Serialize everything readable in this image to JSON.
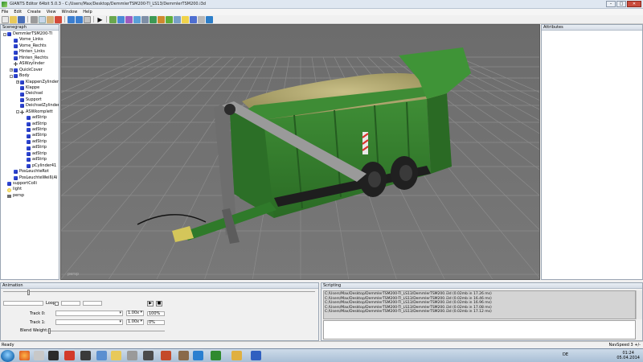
{
  "window": {
    "title": "GIANTS Editor 64bit 5.0.3 - C:/Users/Max/Desktop/DemmlerTSM200-Tl_LS13/DemmlerTSM200.i3d",
    "controls": {
      "minimize": "–",
      "maximize": "□",
      "close": "✕"
    }
  },
  "menu": [
    "File",
    "Edit",
    "Create",
    "View",
    "Window",
    "Help"
  ],
  "toolbar_icons": [
    "new-file-icon",
    "open-file-icon",
    "save-icon",
    "cut-icon",
    "copy-icon",
    "paste-icon",
    "delete-icon",
    "undo-icon",
    "redo-icon",
    "grid-icon",
    "play-icon",
    "move-icon",
    "rotate-icon",
    "scale-icon",
    "select-icon",
    "camera-icon",
    "terrain-icon",
    "paint-icon",
    "foliage-icon",
    "decal-icon",
    "light-icon",
    "shape-icon",
    "particle-icon",
    "navmesh-icon"
  ],
  "scenegraph": {
    "title": "Scenegraph",
    "nodes": [
      {
        "label": "DemmlerTSM200-Tl",
        "icon": "cube",
        "depth": 0,
        "exp": "-"
      },
      {
        "label": "Vorne_Links",
        "icon": "cube",
        "depth": 1
      },
      {
        "label": "Vorne_Rechts",
        "icon": "cube",
        "depth": 1
      },
      {
        "label": "Hinten_Links",
        "icon": "cube",
        "depth": 1
      },
      {
        "label": "Hinten_Rechts",
        "icon": "cube",
        "depth": 1
      },
      {
        "label": "ASWzylinder",
        "icon": "transform",
        "depth": 1
      },
      {
        "label": "QuickCover",
        "icon": "cube",
        "depth": 1,
        "exp": "+"
      },
      {
        "label": "Body",
        "icon": "cube",
        "depth": 1,
        "exp": "-"
      },
      {
        "label": "KlappenZylinder",
        "icon": "cube",
        "depth": 2,
        "exp": "+"
      },
      {
        "label": "Klappe",
        "icon": "cube",
        "depth": 2
      },
      {
        "label": "Deichsel",
        "icon": "cube",
        "depth": 2
      },
      {
        "label": "Support",
        "icon": "cube",
        "depth": 2
      },
      {
        "label": "DeichselZylinder",
        "icon": "cube",
        "depth": 2
      },
      {
        "label": "ASWkomplett",
        "icon": "transform",
        "depth": 2,
        "exp": "-"
      },
      {
        "label": "adStrip",
        "icon": "cube",
        "depth": 3
      },
      {
        "label": "adStrip",
        "icon": "cube",
        "depth": 3
      },
      {
        "label": "adStrip",
        "icon": "cube",
        "depth": 3
      },
      {
        "label": "adStrip",
        "icon": "cube",
        "depth": 3
      },
      {
        "label": "adStrip",
        "icon": "cube",
        "depth": 3
      },
      {
        "label": "adStrip",
        "icon": "cube",
        "depth": 3
      },
      {
        "label": "adStrip",
        "icon": "cube",
        "depth": 3
      },
      {
        "label": "adStrip",
        "icon": "cube",
        "depth": 3
      },
      {
        "label": "pCylinder41",
        "icon": "cube",
        "depth": 3
      },
      {
        "label": "PosLeuchteRot",
        "icon": "cube",
        "depth": 1
      },
      {
        "label": "PosLeuchteWeiß(Al",
        "icon": "cube",
        "depth": 1
      },
      {
        "label": "supportColli",
        "icon": "cube",
        "depth": 0
      },
      {
        "label": "light",
        "icon": "light",
        "depth": 0
      },
      {
        "label": "persp",
        "icon": "camera",
        "depth": 0
      }
    ]
  },
  "viewport": {
    "corner_label": "persp"
  },
  "attributes": {
    "title": "Attributes"
  },
  "animation": {
    "title": "Animation",
    "loop_label": "Loop",
    "track0_label": "Track 0:",
    "track1_label": "Track 1:",
    "speed0": "1.00x",
    "speed1": "1.00x",
    "weight0": "100%",
    "weight1": "0%",
    "blend_label": "Blend Weight:",
    "play_icon": "▶",
    "stop_icon": "■"
  },
  "scripting": {
    "title": "Scripting",
    "log": [
      "C:/Users/Max/Desktop/DemmlerTSM200-Tl_LS13/DemmlerTSM200.i3d (0.02mb in 17.26 ms)",
      "C:/Users/Max/Desktop/DemmlerTSM200-Tl_LS13/DemmlerTSM200.i3d (0.02mb in 16.46 ms)",
      "C:/Users/Max/Desktop/DemmlerTSM200-Tl_LS13/DemmlerTSM200.i3d (0.02mb in 16.96 ms)",
      "C:/Users/Max/Desktop/DemmlerTSM200-Tl_LS13/DemmlerTSM200.i3d (0.02mb in 17.08 ms)",
      "C:/Users/Max/Desktop/DemmlerTSM200-Tl_LS13/DemmlerTSM200.i3d (0.02mb in 17.12 ms)"
    ]
  },
  "status": {
    "left": "Ready",
    "right": "NavSpeed 3 +/-"
  },
  "taskbar": {
    "lang": "DE",
    "time": "01:24",
    "date": "05.04.2014"
  },
  "colors": {
    "trailer_green": "#2f7a2a",
    "viewport_bg": "#6f6f6f",
    "grid_line": "#8a8a8a"
  }
}
